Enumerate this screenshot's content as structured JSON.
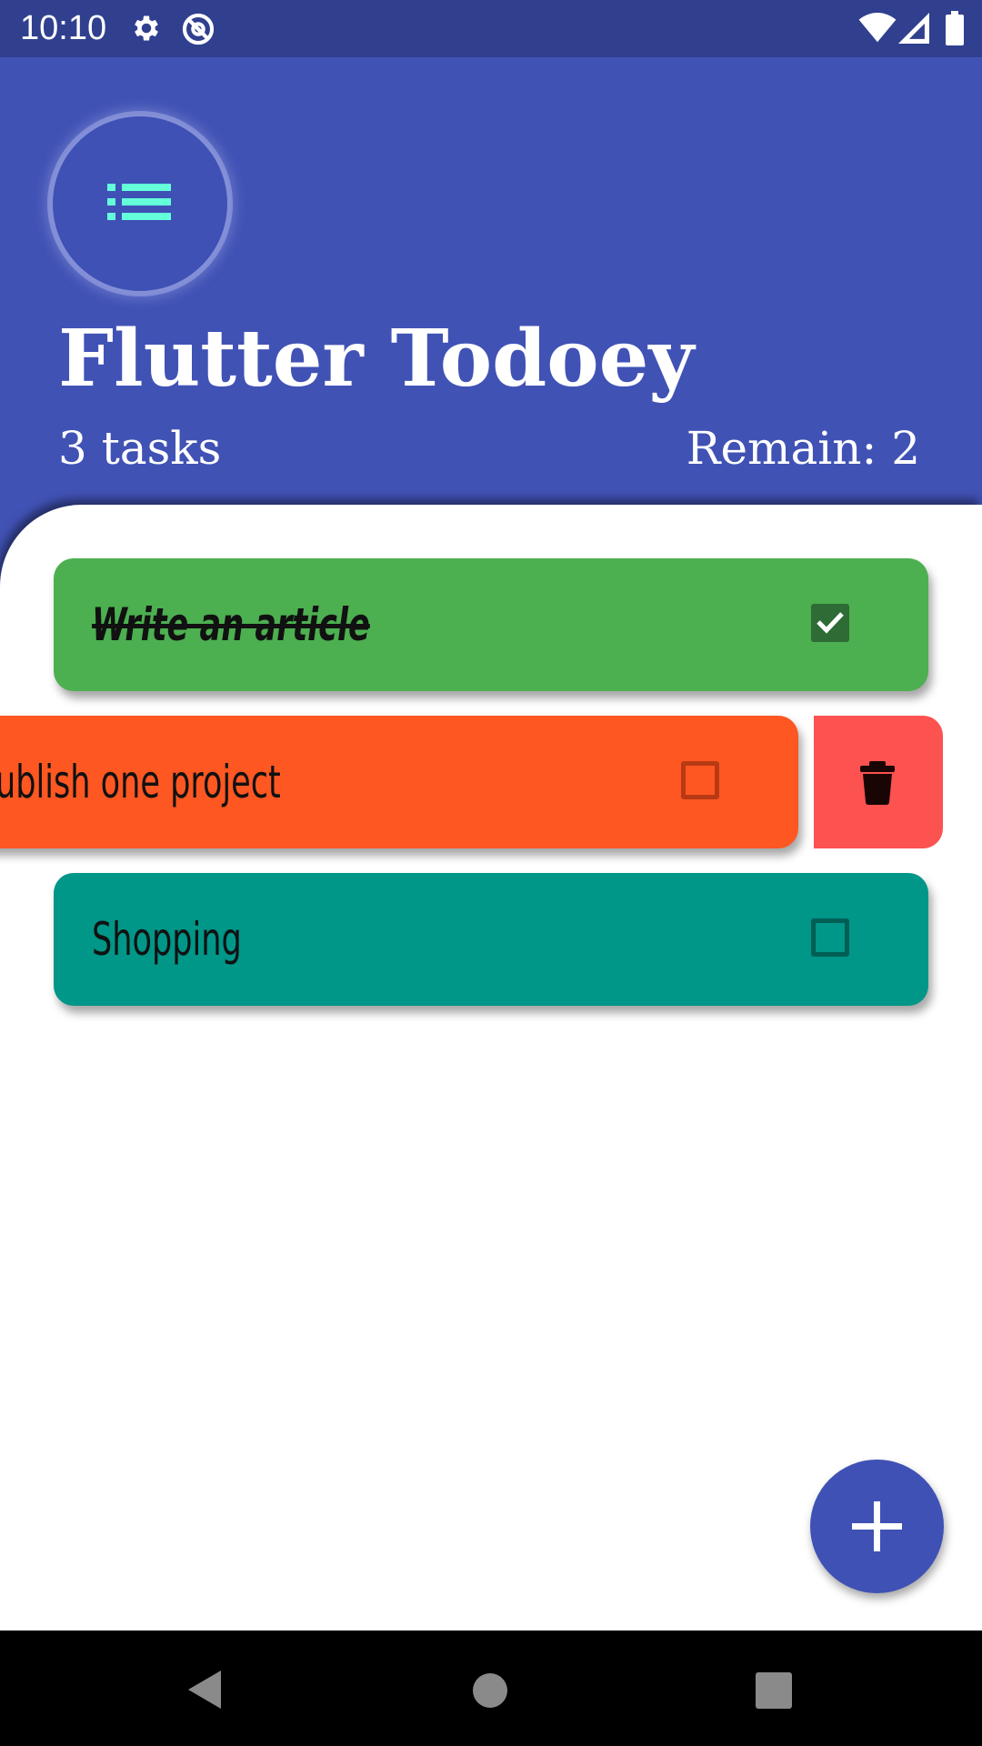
{
  "status_bar": {
    "time": "10:10",
    "icons": [
      "gear-icon",
      "at-sign-icon",
      "wifi-icon",
      "signal-icon",
      "battery-icon"
    ]
  },
  "header": {
    "title": "Flutter Todoey",
    "task_count": "3 tasks",
    "remain": "Remain: 2",
    "logo_icon": "list-icon"
  },
  "tasks": [
    {
      "label": "Write an article",
      "done": true,
      "color": "#4caf50"
    },
    {
      "label": "Publish one project",
      "visible_label": "ublish one project",
      "done": false,
      "color": "#ff5722"
    },
    {
      "label": "Shopping",
      "done": false,
      "color": "#009688"
    }
  ],
  "swipe_action": {
    "icon": "trash-icon",
    "color": "#fc5250"
  },
  "fab": {
    "icon": "plus-icon",
    "color": "#3f51b5"
  },
  "nav": {
    "icons": [
      "back-icon",
      "home-icon",
      "recents-icon"
    ]
  },
  "colors": {
    "primary": "#3f51b5",
    "status_bar": "#303f8e",
    "logo_accent": "#64ffda"
  }
}
